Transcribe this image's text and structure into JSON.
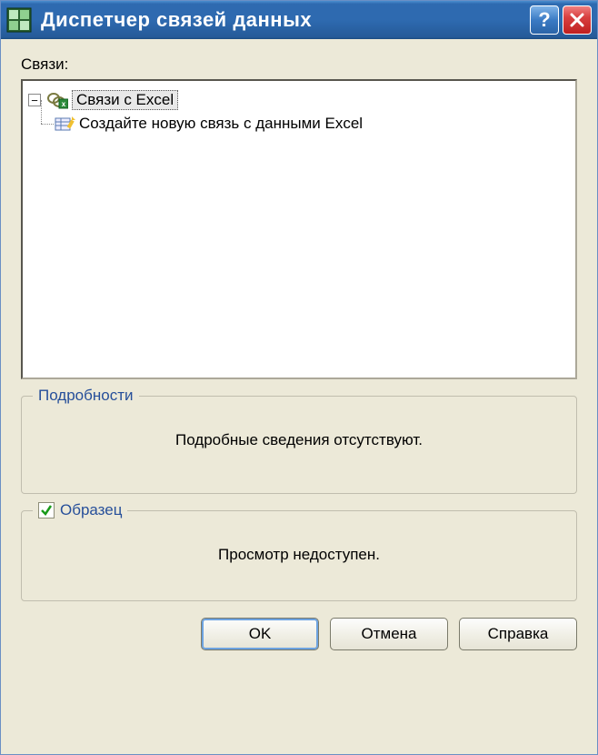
{
  "titlebar": {
    "title": "Диспетчер связей данных"
  },
  "tree": {
    "label": "Связи:",
    "root_label": "Связи с Excel",
    "child_label": "Создайте новую связь с данными Excel"
  },
  "details": {
    "legend": "Подробности",
    "text": "Подробные сведения отсутствуют."
  },
  "sample": {
    "legend": "Образец",
    "text": "Просмотр недоступен."
  },
  "buttons": {
    "ok": "OK",
    "cancel": "Отмена",
    "help": "Справка"
  }
}
